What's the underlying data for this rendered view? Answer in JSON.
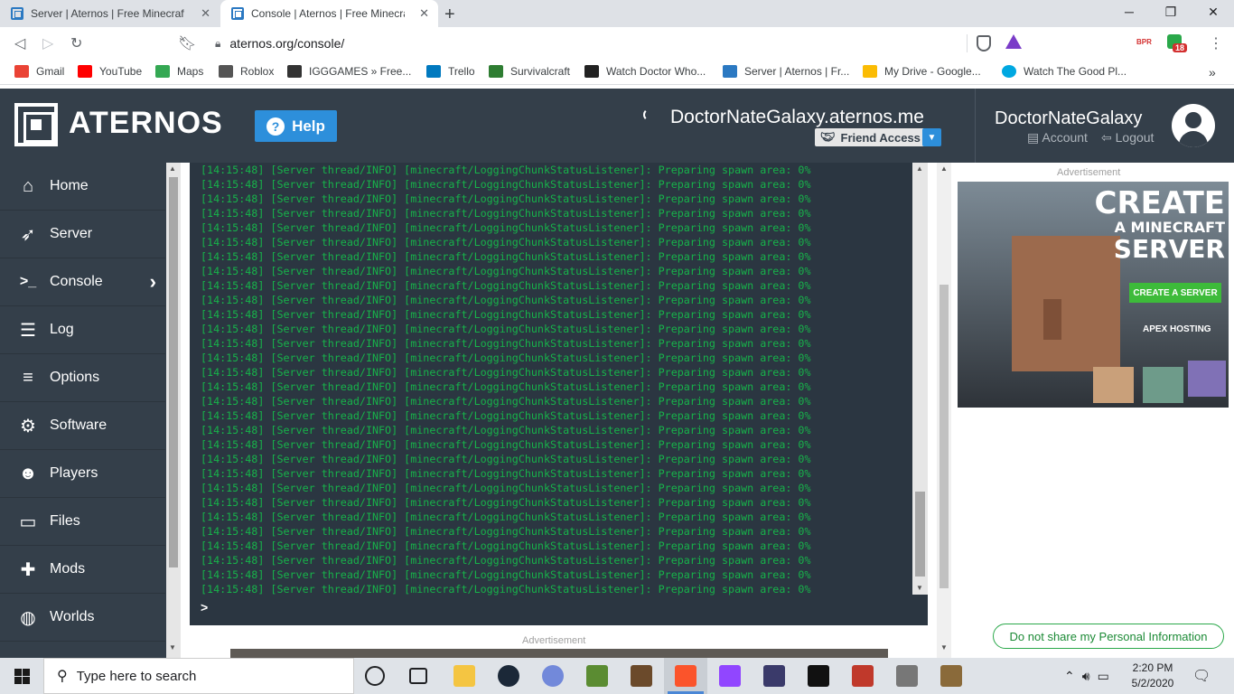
{
  "browser": {
    "tabs": [
      {
        "title": "Server | Aternos | Free Minecraft Se",
        "active": false
      },
      {
        "title": "Console | Aternos | Free Minecraft",
        "active": true
      }
    ],
    "url": "aternos.org/console/",
    "extension_label": "BPR",
    "extension_badge": "18",
    "bookmarks": [
      {
        "label": "Gmail",
        "color": "#ea4335"
      },
      {
        "label": "YouTube",
        "color": "#ff0000"
      },
      {
        "label": "Maps",
        "color": "#34a853"
      },
      {
        "label": "Roblox",
        "color": "#555555"
      },
      {
        "label": "IGGGAMES » Free...",
        "color": "#333333"
      },
      {
        "label": "Trello",
        "color": "#0079bf"
      },
      {
        "label": "Survivalcraft",
        "color": "#2e7d32"
      },
      {
        "label": "Watch Doctor Who...",
        "color": "#222222"
      },
      {
        "label": "Server | Aternos | Fr...",
        "color": "#2b79c2"
      },
      {
        "label": "My Drive - Google...",
        "color": "#fbbc04"
      },
      {
        "label": "Watch The Good Pl...",
        "color": "#00a8e1"
      }
    ]
  },
  "header": {
    "logo": "ATERNOS",
    "help_label": "Help",
    "server_address": "DoctorNateGalaxy.aternos.me",
    "friend_access": "Friend Access",
    "username": "DoctorNateGalaxy",
    "account_label": "Account",
    "logout_label": "Logout"
  },
  "sidebar": {
    "items": [
      {
        "label": "Home",
        "icon": "home-icon",
        "glyph": "⌂"
      },
      {
        "label": "Server",
        "icon": "rocket-icon",
        "glyph": "➶"
      },
      {
        "label": "Console",
        "icon": "terminal-icon",
        "glyph": ">_",
        "active": true
      },
      {
        "label": "Log",
        "icon": "log-icon",
        "glyph": "☰"
      },
      {
        "label": "Options",
        "icon": "sliders-icon",
        "glyph": "≡"
      },
      {
        "label": "Software",
        "icon": "gears-icon",
        "glyph": "⚙"
      },
      {
        "label": "Players",
        "icon": "users-icon",
        "glyph": "👥"
      },
      {
        "label": "Files",
        "icon": "folder-icon",
        "glyph": "🗀"
      },
      {
        "label": "Mods",
        "icon": "puzzle-icon",
        "glyph": "✚"
      },
      {
        "label": "Worlds",
        "icon": "globe-icon",
        "glyph": "◍"
      }
    ]
  },
  "console": {
    "line_text": "[14:15:48] [Server thread/INFO] [minecraft/LoggingChunkStatusListener]: Preparing spawn area: 0%",
    "line_count": 30,
    "prompt": ">"
  },
  "ads": {
    "label": "Advertisement",
    "title_line1": "CREATE",
    "title_line2": "A MINECRAFT",
    "title_line3": "SERVER",
    "cta": "CREATE A SERVER",
    "brand": "APEX HOSTING"
  },
  "privacy_button": "Do not share my Personal Information",
  "taskbar": {
    "search_placeholder": "Type here to search",
    "time": "2:20 PM",
    "date": "5/2/2020"
  }
}
